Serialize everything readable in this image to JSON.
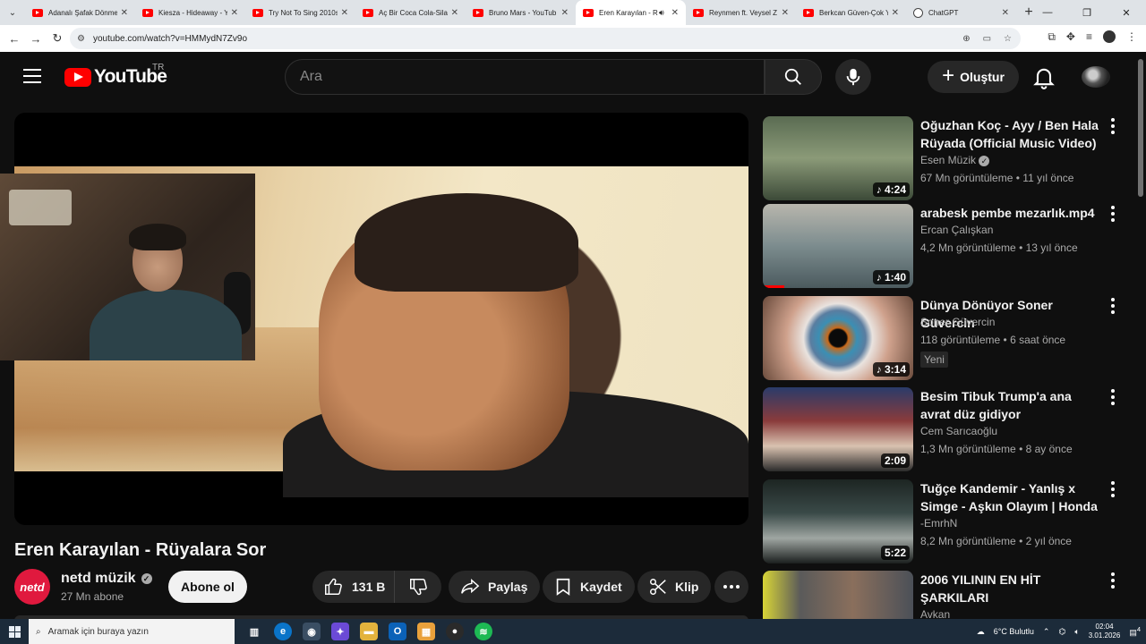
{
  "browser": {
    "tabs": [
      {
        "title": "Adanalı Şafak Dönme",
        "active": false,
        "icon": "youtube-icon"
      },
      {
        "title": "Kiesza - Hideaway - Y",
        "active": false,
        "icon": "youtube-icon"
      },
      {
        "title": "Try Not To Sing 2010s",
        "active": false,
        "icon": "youtube-icon"
      },
      {
        "title": "Aç Bir Coca Cola-Sila",
        "active": false,
        "icon": "youtube-icon"
      },
      {
        "title": "Bruno Mars - YouTub",
        "active": false,
        "icon": "youtube-icon"
      },
      {
        "title": "Eren Karayılan - R",
        "active": true,
        "icon": "youtube-icon",
        "audio": true
      },
      {
        "title": "Reynmen ft. Veysel Z",
        "active": false,
        "icon": "youtube-icon"
      },
      {
        "title": "Berkcan Güven-Çok Y",
        "active": false,
        "icon": "youtube-icon"
      },
      {
        "title": "ChatGPT",
        "active": false,
        "icon": "chatgpt-icon"
      }
    ],
    "url": "youtube.com/watch?v=HMMydN7Zv9o"
  },
  "masthead": {
    "logo_text": "YouTube",
    "country": "TR",
    "search_placeholder": "Ara",
    "create_label": "Oluştur"
  },
  "video": {
    "title": "Eren Karayılan - Rüyalara Sor",
    "channel": "netd müzik",
    "channel_avatar_text": "netd",
    "subscribers": "27 Mn abone",
    "subscribe_label": "Abone ol",
    "likes": "131 B",
    "share_label": "Paylaş",
    "save_label": "Kaydet",
    "clip_label": "Klip"
  },
  "recommendations": [
    {
      "title": "Oğuzhan Koç - Ayy / Ben Hala Rüyada (Official Music Video)",
      "channel": "Esen Müzik",
      "verified": true,
      "views": "67 Mn görüntüleme",
      "age": "11 yıl önce",
      "duration": "4:24",
      "music": true
    },
    {
      "title": "arabesk pembe mezarlık.mp4",
      "channel": "Ercan Çalışkan",
      "verified": false,
      "views": "4,2 Mn görüntüleme",
      "age": "13 yıl önce",
      "duration": "1:40",
      "music": true,
      "watched": true
    },
    {
      "title": "Dünya Dönüyor Soner Güvercin",
      "channel": "Soner Güvercin",
      "verified": false,
      "views": "118 görüntüleme",
      "age": "6 saat önce",
      "duration": "3:14",
      "music": true,
      "badge": "Yeni"
    },
    {
      "title": "Besim Tibuk Trump'a ana avrat düz gidiyor",
      "channel": "Cem Sarıcaoğlu",
      "verified": false,
      "views": "1,3 Mn görüntüleme",
      "age": "8 ay önce",
      "duration": "2:09",
      "music": false
    },
    {
      "title": "Tuğçe Kandemir - Yanlış x Simge - Aşkın Olayım | Honda ...",
      "channel": "-EmrhN",
      "verified": false,
      "views": "8,2 Mn görüntüleme",
      "age": "2 yıl önce",
      "duration": "5:22",
      "music": false
    },
    {
      "title": "2006 YILININ EN HİT ŞARKILARI",
      "channel": "Avkan",
      "verified": false,
      "views": "",
      "age": "",
      "duration": "",
      "music": false
    }
  ],
  "taskbar": {
    "search_placeholder": "Aramak için buraya yazın",
    "weather": "6°C Bulutlu",
    "time": "02:04",
    "date": "3.01.2026",
    "notifications": "4"
  },
  "colors": {
    "youtube_red": "#ff0000",
    "background": "#0f0f0f",
    "button_bg": "#272727"
  }
}
